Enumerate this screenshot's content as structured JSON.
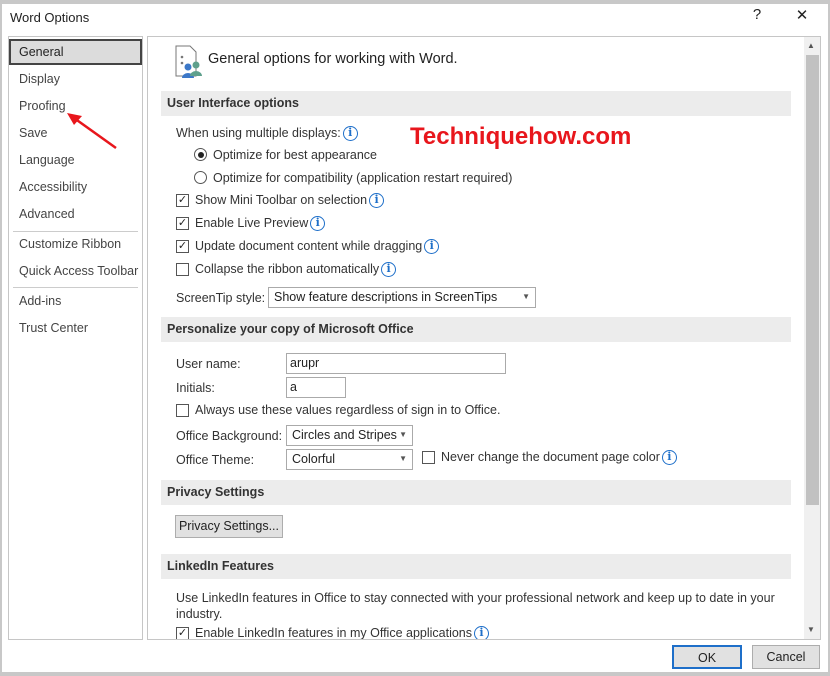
{
  "window": {
    "title": "Word Options",
    "help": "?",
    "close": "✕"
  },
  "sidebar": {
    "items": [
      "General",
      "Display",
      "Proofing",
      "Save",
      "Language",
      "Accessibility",
      "Advanced",
      "Customize Ribbon",
      "Quick Access Toolbar",
      "Add-ins",
      "Trust Center"
    ],
    "selected": "General"
  },
  "header": {
    "title": "General options for working with Word."
  },
  "watermark": "Techniquehow.com",
  "ui": {
    "section": "User Interface options",
    "multi_label": "When using multiple displays:",
    "radio1": "Optimize for best appearance",
    "radio2": "Optimize for compatibility (application restart required)",
    "mini": "Show Mini Toolbar on selection",
    "live": "Enable Live Preview",
    "update": "Update document content while dragging",
    "collapse": "Collapse the ribbon automatically",
    "screentip_label": "ScreenTip style:",
    "screentip_value": "Show feature descriptions in ScreenTips"
  },
  "personal": {
    "section": "Personalize your copy of Microsoft Office",
    "user_label": "User name:",
    "user_value": "arupr",
    "initials_label": "Initials:",
    "initials_value": "a",
    "always": "Always use these values regardless of sign in to Office.",
    "bg_label": "Office Background:",
    "bg_value": "Circles and Stripes",
    "theme_label": "Office Theme:",
    "theme_value": "Colorful",
    "never": "Never change the document page color"
  },
  "privacy": {
    "section": "Privacy Settings",
    "button": "Privacy Settings..."
  },
  "linkedin": {
    "section": "LinkedIn Features",
    "desc1": "Use LinkedIn features in Office to stay connected with your professional network and keep up to date in your",
    "desc2": "industry.",
    "enable": "Enable LinkedIn features in my Office applications"
  },
  "footer": {
    "ok": "OK",
    "cancel": "Cancel"
  },
  "colors": {
    "accent": "#1e6fc9",
    "watermark": "#e8161c",
    "arrow": "#e8161c"
  }
}
